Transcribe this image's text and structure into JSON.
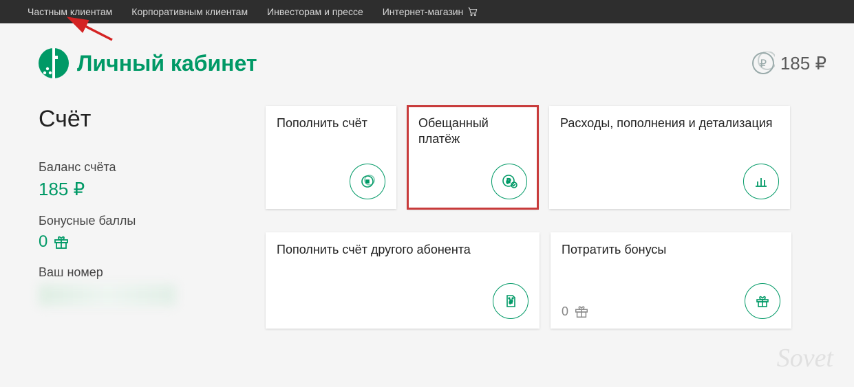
{
  "topnav": {
    "items": [
      {
        "label": "Частным клиентам"
      },
      {
        "label": "Корпоративным клиентам"
      },
      {
        "label": "Инвесторам и прессе"
      },
      {
        "label": "Интернет-магазин"
      }
    ]
  },
  "header": {
    "title": "Личный кабинет",
    "balance_display": "185 ₽"
  },
  "sidebar": {
    "section_title": "Счёт",
    "balance_label": "Баланс счёта",
    "balance_value": "185 ₽",
    "bonus_label": "Бонусные баллы",
    "bonus_value": "0",
    "phone_label": "Ваш номер"
  },
  "cards": {
    "topup": {
      "title": "Пополнить счёт"
    },
    "promised": {
      "title": "Обещанный платёж"
    },
    "expenses": {
      "title": "Расходы, пополнения и детализация"
    },
    "topup_other": {
      "title": "Пополнить счёт другого абонента"
    },
    "spend_bonus": {
      "title": "Потратить бонусы",
      "count": "0"
    }
  },
  "colors": {
    "accent": "#009966",
    "highlight": "#c83b3b"
  },
  "watermark": "Sovet"
}
